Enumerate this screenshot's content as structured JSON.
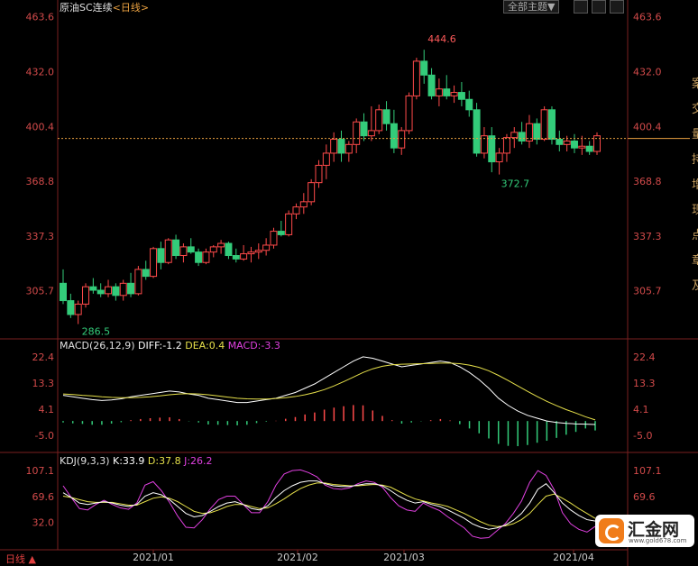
{
  "header": {
    "instrument": "原油SC连续",
    "period_link": "<日线>",
    "theme_button": "全部主题▼"
  },
  "bottom_tab": "日线 ▲",
  "side_glyphs": [
    "案",
    "交",
    "量",
    "持",
    "增",
    "现",
    "点",
    "章",
    "及"
  ],
  "watermark": {
    "name": "汇金网",
    "url": "www.gold678.com"
  },
  "colors": {
    "up": "#ff4a4a",
    "down": "#33cc7a",
    "diff": "#ffffff",
    "dea": "#e6e04a",
    "k": "#ffffff",
    "d": "#e6e04a",
    "j": "#e040e0",
    "axis": "#d24a4a",
    "last": "#e8a040"
  },
  "chart_data": [
    {
      "type": "candlestick",
      "title": "原油SC连续",
      "y_ticks": [
        "463.6",
        "432.0",
        "400.4",
        "368.8",
        "337.3",
        "305.7"
      ],
      "ylim": [
        279,
        466
      ],
      "x_ticks": [
        "2021/01",
        "2021/02",
        "2021/03",
        "2021/04"
      ],
      "last_price": 393.5,
      "annotations": {
        "high": "444.6",
        "low": "286.5",
        "recent_low": "372.7"
      },
      "candles": [
        [
          310,
          318,
          298,
          300
        ],
        [
          300,
          304,
          290,
          292
        ],
        [
          292,
          300,
          286.5,
          298
        ],
        [
          298,
          310,
          296,
          308
        ],
        [
          308,
          313,
          304,
          306
        ],
        [
          306,
          310,
          302,
          304
        ],
        [
          304,
          312,
          302,
          308
        ],
        [
          308,
          310,
          300,
          303
        ],
        [
          303,
          312,
          300,
          310
        ],
        [
          310,
          316,
          302,
          304
        ],
        [
          304,
          320,
          303,
          318
        ],
        [
          318,
          323,
          312,
          314
        ],
        [
          314,
          331,
          313,
          330
        ],
        [
          330,
          334,
          318,
          322
        ],
        [
          322,
          336,
          321,
          335
        ],
        [
          335,
          338,
          324,
          326
        ],
        [
          326,
          333,
          322,
          331
        ],
        [
          331,
          336,
          327,
          328
        ],
        [
          328,
          330,
          320,
          322
        ],
        [
          322,
          330,
          321,
          328
        ],
        [
          328,
          332,
          325,
          331
        ],
        [
          331,
          335,
          327,
          333
        ],
        [
          333,
          334,
          324,
          326
        ],
        [
          326,
          330,
          322,
          324
        ],
        [
          324,
          332,
          323,
          327
        ],
        [
          327,
          331,
          322,
          328
        ],
        [
          328,
          333,
          324,
          329
        ],
        [
          329,
          336,
          326,
          332
        ],
        [
          332,
          342,
          330,
          340
        ],
        [
          340,
          346,
          337,
          338
        ],
        [
          338,
          352,
          337,
          350
        ],
        [
          350,
          356,
          347,
          354
        ],
        [
          354,
          362,
          350,
          357
        ],
        [
          357,
          370,
          355,
          368
        ],
        [
          368,
          381,
          365,
          378
        ],
        [
          378,
          390,
          370,
          385
        ],
        [
          385,
          397,
          380,
          393
        ],
        [
          393,
          398,
          380,
          385
        ],
        [
          385,
          392,
          380,
          390
        ],
        [
          390,
          405,
          385,
          403
        ],
        [
          403,
          408,
          392,
          395
        ],
        [
          395,
          412,
          392,
          398
        ],
        [
          398,
          413,
          396,
          410
        ],
        [
          410,
          415,
          398,
          402
        ],
        [
          402,
          410,
          385,
          388
        ],
        [
          388,
          400,
          384,
          398
        ],
        [
          398,
          420,
          396,
          418
        ],
        [
          418,
          440,
          416,
          438
        ],
        [
          438,
          444.6,
          425,
          430
        ],
        [
          430,
          434,
          416,
          418
        ],
        [
          418,
          428,
          412,
          422
        ],
        [
          422,
          430,
          416,
          418
        ],
        [
          418,
          424,
          414,
          420
        ],
        [
          420,
          426,
          412,
          416
        ],
        [
          416,
          421,
          406,
          410
        ],
        [
          410,
          414,
          383,
          385
        ],
        [
          385,
          400,
          382,
          395
        ],
        [
          395,
          400,
          374,
          380
        ],
        [
          380,
          388,
          372.7,
          385
        ],
        [
          385,
          396,
          380,
          394
        ],
        [
          394,
          400,
          388,
          397
        ],
        [
          397,
          403,
          390,
          392
        ],
        [
          392,
          407,
          388,
          402
        ],
        [
          402,
          405,
          390,
          393
        ],
        [
          393,
          412,
          392,
          410
        ],
        [
          410,
          412,
          390,
          393
        ],
        [
          393,
          398,
          386,
          390
        ],
        [
          390,
          395,
          386,
          392
        ],
        [
          392,
          396,
          385,
          388
        ],
        [
          388,
          395,
          384,
          389
        ],
        [
          389,
          392,
          384,
          386
        ],
        [
          386,
          397,
          384,
          395
        ]
      ]
    },
    {
      "type": "line",
      "title": "MACD(26,12,9)",
      "legend": [
        "DIFF:-1.2",
        "DEA:0.4",
        "MACD:-3.3"
      ],
      "y_ticks": [
        "22.4",
        "13.3",
        "4.1",
        "-5.0"
      ],
      "ylim": [
        -11,
        25
      ],
      "series": [
        {
          "name": "DIFF",
          "values": [
            9,
            8.5,
            8,
            7.5,
            7.2,
            7.4,
            7.8,
            8.5,
            9,
            9.5,
            10,
            10.5,
            10.2,
            9.5,
            9,
            8,
            7.5,
            7,
            6.5,
            6.5,
            7,
            7.5,
            8,
            9,
            10,
            11.5,
            13,
            15,
            17,
            19,
            21,
            22.5,
            22,
            21,
            20,
            19,
            19.5,
            20,
            20.5,
            21,
            20.5,
            19,
            17,
            14.5,
            11.5,
            8,
            5.5,
            3.5,
            2,
            1,
            0,
            -0.5,
            -0.8,
            -1,
            -1.1,
            -1.2
          ]
        },
        {
          "name": "DEA",
          "values": [
            9.5,
            9.3,
            9,
            8.8,
            8.5,
            8.3,
            8.2,
            8.2,
            8.3,
            8.5,
            8.8,
            9.2,
            9.5,
            9.6,
            9.5,
            9.2,
            8.8,
            8.4,
            8,
            7.8,
            7.7,
            7.7,
            7.9,
            8.2,
            8.6,
            9.2,
            10,
            11,
            12.3,
            13.8,
            15.4,
            17,
            18.3,
            19.2,
            19.7,
            19.9,
            20,
            20.1,
            20.2,
            20.3,
            20.3,
            20.1,
            19.6,
            18.8,
            17.6,
            16,
            14.2,
            12.3,
            10.4,
            8.6,
            6.9,
            5.4,
            4,
            2.8,
            1.5,
            0.4
          ]
        },
        {
          "name": "MACD",
          "values": [
            -0.5,
            -0.8,
            -1,
            -1.3,
            -1.3,
            -0.9,
            -0.4,
            0.3,
            0.7,
            1,
            1.2,
            1.3,
            0.7,
            -0.1,
            -0.5,
            -1.2,
            -1.3,
            -1.4,
            -1.5,
            -1.3,
            -0.7,
            -0.2,
            0.1,
            0.8,
            1.4,
            2.3,
            3,
            4,
            4.7,
            5.2,
            5.6,
            5.5,
            3.7,
            1.8,
            0.3,
            -0.9,
            -0.5,
            -0.1,
            0.3,
            0.7,
            0.2,
            -1.1,
            -2.6,
            -4.3,
            -6.1,
            -8,
            -8.7,
            -8.8,
            -8.4,
            -7.6,
            -6.9,
            -5.9,
            -4.8,
            -3.8,
            -2.6,
            -3.3
          ]
        }
      ]
    },
    {
      "type": "line",
      "title": "KDJ(9,3,3)",
      "legend": [
        "K:33.9",
        "D:37.8",
        "J:26.2"
      ],
      "y_ticks": [
        "107.1",
        "69.6",
        "32.0"
      ],
      "ylim": [
        -5,
        115
      ],
      "series": [
        {
          "name": "K",
          "values": [
            75,
            68,
            60,
            58,
            60,
            62,
            60,
            57,
            55,
            58,
            70,
            75,
            72,
            65,
            55,
            45,
            40,
            42,
            48,
            55,
            60,
            62,
            58,
            52,
            50,
            56,
            68,
            78,
            85,
            90,
            92,
            92,
            88,
            85,
            84,
            84,
            86,
            88,
            88,
            85,
            78,
            70,
            64,
            60,
            62,
            58,
            55,
            50,
            44,
            38,
            30,
            25,
            22,
            24,
            28,
            35,
            45,
            60,
            80,
            88,
            75,
            60,
            50,
            42,
            36,
            33.9
          ]
        },
        {
          "name": "D",
          "values": [
            70,
            68,
            65,
            62,
            61,
            61,
            61,
            59,
            57,
            57,
            62,
            67,
            69,
            67,
            62,
            55,
            48,
            45,
            46,
            50,
            55,
            58,
            58,
            55,
            52,
            53,
            59,
            66,
            74,
            81,
            86,
            89,
            89,
            87,
            86,
            85,
            85,
            86,
            87,
            86,
            83,
            77,
            71,
            66,
            63,
            60,
            58,
            55,
            50,
            45,
            39,
            33,
            28,
            26,
            27,
            30,
            36,
            45,
            58,
            70,
            73,
            67,
            60,
            52,
            45,
            37.8
          ]
        },
        {
          "name": "J",
          "values": [
            85,
            68,
            52,
            50,
            58,
            64,
            58,
            53,
            51,
            60,
            86,
            91,
            78,
            61,
            41,
            25,
            24,
            36,
            52,
            65,
            70,
            70,
            58,
            46,
            46,
            62,
            86,
            102,
            107,
            108,
            104,
            98,
            86,
            81,
            80,
            82,
            88,
            92,
            90,
            83,
            68,
            56,
            50,
            48,
            60,
            54,
            49,
            40,
            32,
            24,
            12,
            9,
            10,
            20,
            30,
            45,
            63,
            90,
            107,
            100,
            79,
            46,
            30,
            22,
            18,
            26.2
          ]
        }
      ]
    }
  ]
}
